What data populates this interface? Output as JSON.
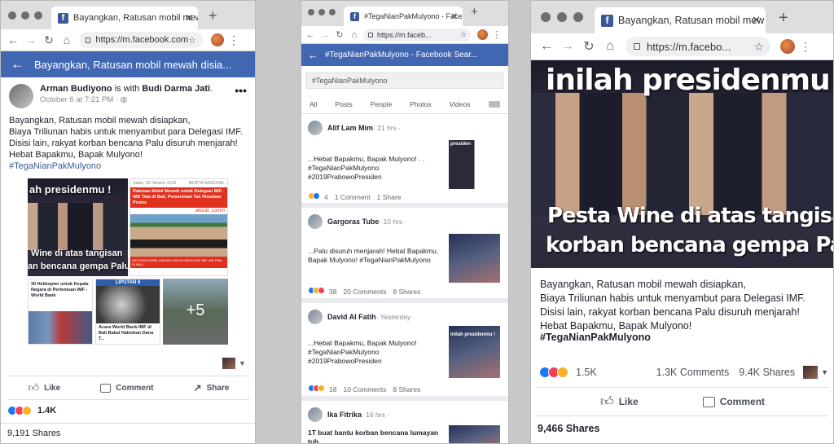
{
  "w1": {
    "tab_title": "Bayangkan, Ratusan mobil mew",
    "url": "https://m.facebook.com",
    "bar_title": "Bayangkan, Ratusan mobil mewah disia...",
    "author": "Arman Budiyono",
    "is_with": "is with",
    "with_name": "Budi Darma Jati",
    "time": "October 6 at 7:21 PM · ",
    "text": "Bayangkan, Ratusan mobil mewah disiapkan,\nBiaya Triliunan habis untuk menyambut para Delegasi IMF.\nDisisi lain, rakyat korban bencana Palu disuruh menjarah!\nHebat Bapakmu, Bapak Mulyono!",
    "hashtag": "#TegaNianPakMulyono",
    "img1_top": "ah presidenmu !",
    "img1_bottom1": "Wine di atas tangisan",
    "img1_bottom2": "an bencana gempa Palu.",
    "img2_date": "Sabtu, 06 Oktober 2018",
    "img2_cat": "BERITA NASIONAL",
    "img2_headline": "Ratusan Mobil Mewah untuk Delegasi IMF-WB Tiba di Bali, Pemerintah Tak Hiraukan Protes",
    "img2_source": "akurat_com/n",
    "img2_caption": "RATUSAN MOBIL MEWAH UNTUK DELEGASI IMF-WB TIBA DI BALI",
    "img3_text": "30 Helikopter untuk Kepala Negara di Pertemuan IMF - World Bank",
    "img4_brand": "LIPUTAN 6",
    "img4_text": "Acara World Bank-IMF di Bali Bakal Habiskan Dana T...",
    "more_count": "+5",
    "like": "Like",
    "comment": "Comment",
    "share": "Share",
    "reactions": "1.4K",
    "shares": "9,191 Shares"
  },
  "w2": {
    "tab_title": "#TegaNianPakMulyono - Faceb",
    "url": "https://m.faceb...",
    "bar_title": "#TegaNianPakMulyono - Facebook Sear...",
    "search_value": "#TegaNianPakMulyono",
    "tabs": [
      "All",
      "Posts",
      "People",
      "Photos",
      "Videos"
    ],
    "results": [
      {
        "name": "Alif Lam Mim",
        "time": " · 21 hrs ·",
        "text": "...Hebat Bapakmu, Bapak Mulyono! . .\n#TegaNianPakMulyono\n#2019PrabowoPresiden",
        "count": "4",
        "comments": "1 Comment",
        "shares": "1 Share",
        "thumb": "presiden"
      },
      {
        "name": "Gargoras Tube",
        "time": " · 10 hrs ·",
        "text": "...Palu disuruh menjarah! Hebat Bapakmu,\nBapak Mulyono! #TegaNianPakMulyono",
        "count": "38",
        "comments": "20 Comments",
        "shares": "8 Shares",
        "thumb": ""
      },
      {
        "name": "David Al Fatih",
        "time": " · Yesterday ·",
        "text": "...Hebat Bapakmu, Bapak Mulyono!\n#TegaNianPakMulyono\n#2019PrabowoPresiden",
        "count": "18",
        "comments": "10 Comments",
        "shares": "8 Shares",
        "thumb": "inilah presidenmu !"
      },
      {
        "name": "Ika Fitrika",
        "time": " · 16 hrs ·",
        "text": "1T buat bantu korban bencana lumayan\ntuh..",
        "count": "",
        "comments": "",
        "shares": "",
        "thumb": ""
      }
    ]
  },
  "w3": {
    "tab_title": "Bayangkan, Ratusan mobil mew",
    "url": "https://m.facebo...",
    "img_top": "inilah presidenmu !",
    "img_bottom1": "Pesta Wine di atas tangisan",
    "img_bottom2": "korban bencana gempa Palu.",
    "text": "Bayangkan, Ratusan mobil mewah disiapkan,\nBiaya Triliunan habis untuk menyambut para Delegasi IMF.\nDisisi lain, rakyat korban bencana Palu disuruh menjarah!\nHebat Bapakmu, Bapak Mulyono!",
    "hashtag": "#TegaNianPakMulyono",
    "reactions": "1.5K",
    "comments": "1.3K Comments",
    "shares_count": "9.4K Shares",
    "like": "Like",
    "comment": "Comment",
    "shares": "9,466 Shares"
  },
  "colors": {
    "fb_blue": "#4267b2",
    "link": "#385898"
  }
}
